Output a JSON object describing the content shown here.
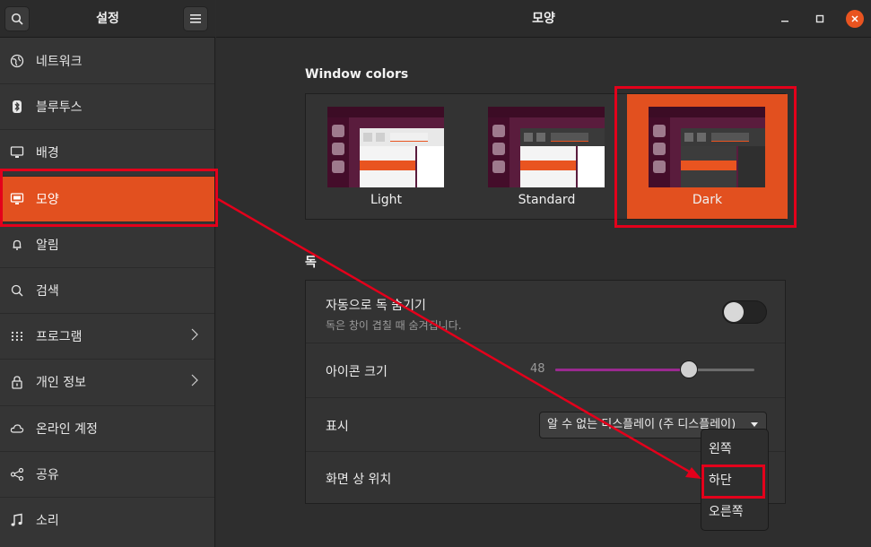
{
  "sidebar": {
    "title": "설정",
    "items": [
      {
        "label": "네트워크",
        "icon": "globe-icon"
      },
      {
        "label": "블루투스",
        "icon": "bluetooth-icon"
      },
      {
        "label": "배경",
        "icon": "monitor-icon"
      },
      {
        "label": "모양",
        "icon": "appearance-icon",
        "active": true
      },
      {
        "label": "알림",
        "icon": "bell-icon"
      },
      {
        "label": "검색",
        "icon": "search-icon"
      },
      {
        "label": "프로그램",
        "icon": "apps-grid-icon",
        "chevron": true
      },
      {
        "label": "개인 정보",
        "icon": "lock-icon",
        "chevron": true
      },
      {
        "label": "온라인 계정",
        "icon": "cloud-icon"
      },
      {
        "label": "공유",
        "icon": "share-icon"
      },
      {
        "label": "소리",
        "icon": "music-note-icon"
      }
    ]
  },
  "main": {
    "title": "모양",
    "window_colors": {
      "title": "Window colors",
      "options": [
        "Light",
        "Standard",
        "Dark"
      ],
      "selected": "Dark"
    },
    "dock": {
      "title": "독",
      "autohide": {
        "label": "자동으로 독 숨기기",
        "description": "독은 창이 겹칠 때 숨겨집니다.",
        "enabled": false
      },
      "icon_size": {
        "label": "아이콘 크기",
        "value": "48",
        "fraction": 0.67
      },
      "display": {
        "label": "표시",
        "value": "알 수 없는 디스플레이 (주 디스플레이)"
      },
      "position": {
        "label": "화면 상 위치",
        "options": [
          "왼쪽",
          "하단",
          "오른쪽"
        ],
        "selected": "하단"
      }
    }
  },
  "colors": {
    "accent": "#e2501f",
    "annotation_red": "#e3001b"
  }
}
